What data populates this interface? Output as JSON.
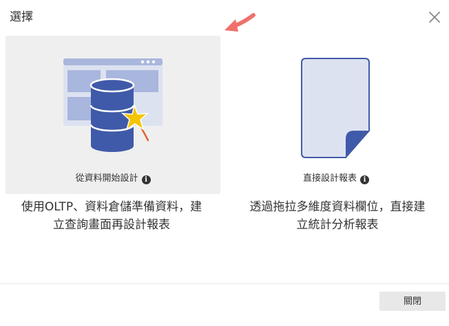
{
  "dialog": {
    "title": "選擇",
    "close_icon": "close-icon",
    "pointer_icon": "arrow-pointer-icon"
  },
  "options": [
    {
      "label": "從資料開始設計",
      "icon": "database-wizard-icon",
      "info_icon": "info-icon",
      "selected": true,
      "description_lines": [
        "使用OLTP、資料倉儲準備資料，建",
        "立查詢畫面再設計報表"
      ]
    },
    {
      "label": "直接設計報表",
      "icon": "blank-document-icon",
      "info_icon": "info-icon",
      "selected": false,
      "description_lines": [
        "透過拖拉多維度資料欄位，直接建",
        "立統計分析報表"
      ]
    }
  ],
  "footer": {
    "close_label": "關閉"
  },
  "colors": {
    "accent_blue": "#3f5aa8",
    "light_blue": "#dde2f1",
    "panel_blue": "#a9b6dd",
    "star_yellow": "#f5c400",
    "arrow_red": "#f0716b",
    "selected_bg": "#efefef"
  }
}
